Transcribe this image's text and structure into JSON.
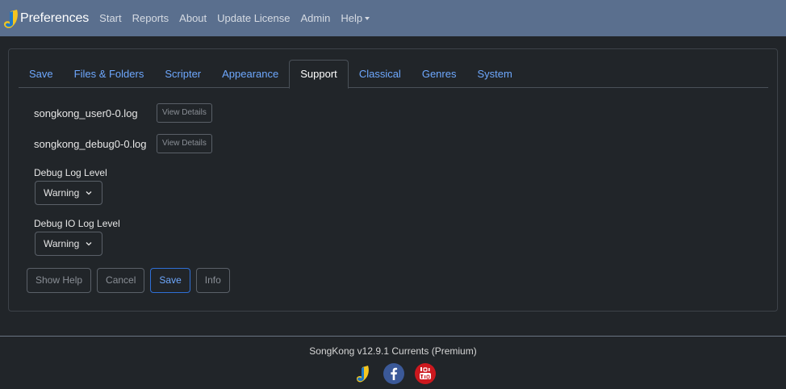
{
  "navbar": {
    "brand": "Preferences",
    "links": [
      "Start",
      "Reports",
      "About",
      "Update License",
      "Admin",
      "Help"
    ]
  },
  "tabs": [
    "Save",
    "Files & Folders",
    "Scripter",
    "Appearance",
    "Support",
    "Classical",
    "Genres",
    "System"
  ],
  "active_tab": "Support",
  "logs": [
    {
      "name": "songkong_user0-0.log",
      "button": "View Details"
    },
    {
      "name": "songkong_debug0-0.log",
      "button": "View Details"
    }
  ],
  "debug_log_level": {
    "label": "Debug Log Level",
    "value": "Warning"
  },
  "debug_io_log_level": {
    "label": "Debug IO Log Level",
    "value": "Warning"
  },
  "buttons": {
    "show_help": "Show Help",
    "cancel": "Cancel",
    "save": "Save",
    "info": "Info"
  },
  "footer": {
    "version": "SongKong v12.9.1 Currents (Premium)"
  },
  "colors": {
    "navbar": "#5a6f8e",
    "background": "#212529",
    "link": "#6ea8fe",
    "facebook": "#3b5998",
    "youtube": "#cc181e"
  }
}
